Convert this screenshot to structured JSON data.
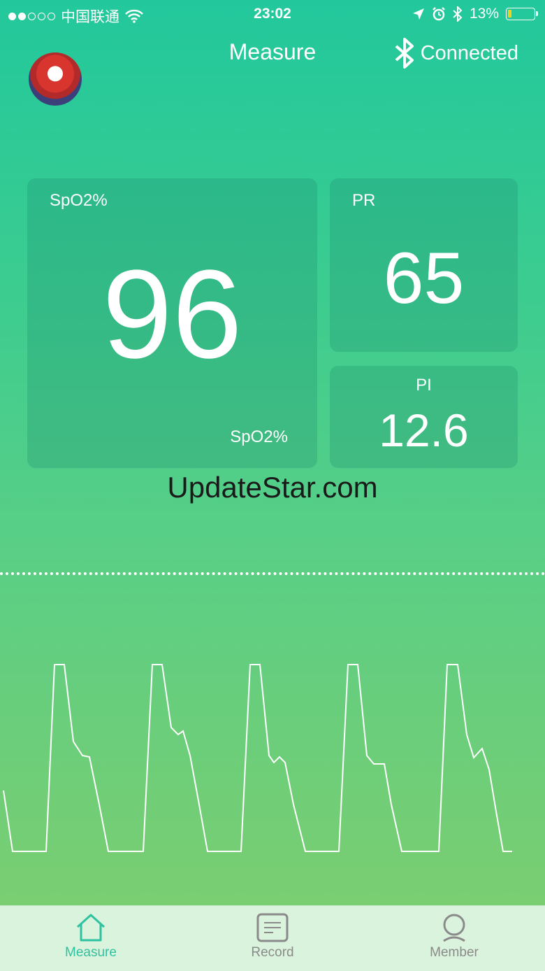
{
  "status_bar": {
    "carrier": "中国联通",
    "time": "23:02",
    "battery": "13%",
    "battery_level": 0.13,
    "signal_bars_filled": 2,
    "signal_bars_total": 5
  },
  "header": {
    "title": "Measure",
    "connection_status": "Connected",
    "connection_icon": "bluetooth-icon"
  },
  "readings": {
    "spo2": {
      "label": "SpO2%",
      "value": "96",
      "unit": "SpO2%"
    },
    "pr": {
      "label": "PR",
      "value": "65"
    },
    "pi": {
      "label": "PI",
      "value": "12.6"
    }
  },
  "watermark": "UpdateStar.com",
  "tabs": [
    {
      "label": "Measure",
      "icon": "home-icon",
      "active": true
    },
    {
      "label": "Record",
      "icon": "record-icon",
      "active": false
    },
    {
      "label": "Member",
      "icon": "member-icon",
      "active": false
    }
  ],
  "colors": {
    "accent": "#2fc2a0",
    "battery_low": "#f4d21c",
    "tab_inactive": "#8a8a8a"
  }
}
